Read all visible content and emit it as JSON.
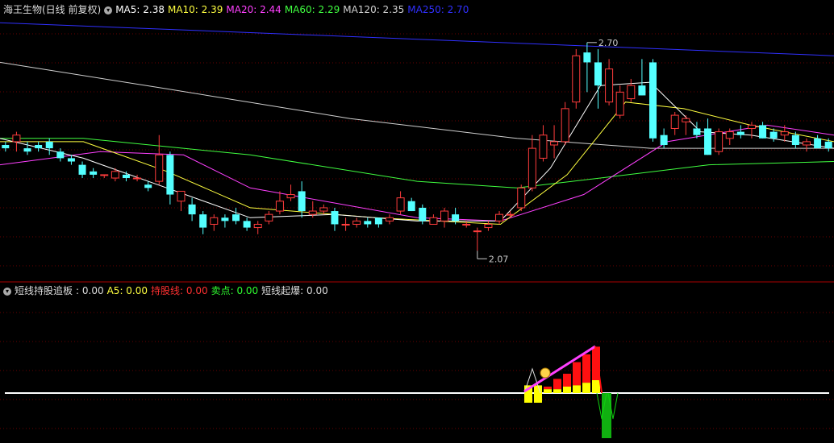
{
  "main_panel": {
    "title": "海王生物(日线 前复权)",
    "indicators": [
      {
        "label": "MA5:",
        "value": "2.38",
        "color": "#ffffff"
      },
      {
        "label": "MA10:",
        "value": "2.39",
        "color": "#ffff40"
      },
      {
        "label": "MA20:",
        "value": "2.44",
        "color": "#ff40ff"
      },
      {
        "label": "MA60:",
        "value": "2.29",
        "color": "#40ff40"
      },
      {
        "label": "MA120:",
        "value": "2.35",
        "color": "#d0d0d0"
      },
      {
        "label": "MA250:",
        "value": "2.70",
        "color": "#3030ff"
      }
    ],
    "high_label": "2.70",
    "low_label": "2.07"
  },
  "sub_panel": {
    "title": "短线持股追板",
    "indicators": [
      {
        "label": ": ",
        "value": "0.00",
        "color": "#dddddd"
      },
      {
        "label": "A5:",
        "value": "0.00",
        "color": "#ffff40"
      },
      {
        "label": "持股线:",
        "value": "0.00",
        "color": "#ff3030"
      },
      {
        "label": "卖点:",
        "value": "0.00",
        "color": "#30ff30"
      },
      {
        "label": "短线起爆:",
        "value": "0.00",
        "color": "#dddddd"
      }
    ]
  },
  "chart_data": {
    "type": "candlestick",
    "price_range": [
      2.0,
      2.78
    ],
    "candles": [
      [
        2.39,
        2.4,
        2.37,
        2.38
      ],
      [
        2.4,
        2.43,
        2.37,
        2.42
      ],
      [
        2.38,
        2.4,
        2.36,
        2.37
      ],
      [
        2.39,
        2.4,
        2.37,
        2.38
      ],
      [
        2.4,
        2.41,
        2.36,
        2.38
      ],
      [
        2.37,
        2.38,
        2.34,
        2.35
      ],
      [
        2.35,
        2.36,
        2.33,
        2.34
      ],
      [
        2.33,
        2.34,
        2.29,
        2.3
      ],
      [
        2.31,
        2.32,
        2.29,
        2.3
      ],
      [
        2.3,
        2.3,
        2.29,
        2.3
      ],
      [
        2.29,
        2.32,
        2.28,
        2.31
      ],
      [
        2.3,
        2.31,
        2.28,
        2.29
      ],
      [
        2.29,
        2.3,
        2.28,
        2.29
      ],
      [
        2.27,
        2.28,
        2.25,
        2.26
      ],
      [
        2.28,
        2.42,
        2.27,
        2.36
      ],
      [
        2.36,
        2.37,
        2.21,
        2.24
      ],
      [
        2.22,
        2.25,
        2.19,
        2.25
      ],
      [
        2.21,
        2.23,
        2.16,
        2.18
      ],
      [
        2.18,
        2.19,
        2.12,
        2.14
      ],
      [
        2.15,
        2.18,
        2.13,
        2.17
      ],
      [
        2.17,
        2.18,
        2.14,
        2.16
      ],
      [
        2.18,
        2.2,
        2.15,
        2.16
      ],
      [
        2.16,
        2.17,
        2.13,
        2.14
      ],
      [
        2.14,
        2.16,
        2.12,
        2.15
      ],
      [
        2.16,
        2.19,
        2.15,
        2.18
      ],
      [
        2.19,
        2.25,
        2.18,
        2.22
      ],
      [
        2.23,
        2.27,
        2.22,
        2.24
      ],
      [
        2.25,
        2.28,
        2.17,
        2.19
      ],
      [
        2.18,
        2.22,
        2.17,
        2.19
      ],
      [
        2.19,
        2.21,
        2.18,
        2.2
      ],
      [
        2.19,
        2.2,
        2.13,
        2.15
      ],
      [
        2.15,
        2.17,
        2.13,
        2.15
      ],
      [
        2.15,
        2.17,
        2.14,
        2.16
      ],
      [
        2.16,
        2.17,
        2.14,
        2.15
      ],
      [
        2.17,
        2.17,
        2.14,
        2.15
      ],
      [
        2.16,
        2.18,
        2.15,
        2.17
      ],
      [
        2.19,
        2.25,
        2.18,
        2.23
      ],
      [
        2.22,
        2.23,
        2.19,
        2.19
      ],
      [
        2.2,
        2.21,
        2.15,
        2.16
      ],
      [
        2.15,
        2.18,
        2.15,
        2.17
      ],
      [
        2.16,
        2.2,
        2.14,
        2.19
      ],
      [
        2.18,
        2.2,
        2.15,
        2.16
      ],
      [
        2.15,
        2.16,
        2.14,
        2.15
      ],
      [
        2.13,
        2.14,
        2.07,
        2.13
      ],
      [
        2.14,
        2.16,
        2.13,
        2.15
      ],
      [
        2.16,
        2.19,
        2.15,
        2.18
      ],
      [
        2.18,
        2.19,
        2.17,
        2.18
      ],
      [
        2.2,
        2.27,
        2.19,
        2.26
      ],
      [
        2.26,
        2.42,
        2.25,
        2.38
      ],
      [
        2.35,
        2.45,
        2.34,
        2.42
      ],
      [
        2.39,
        2.45,
        2.35,
        2.4
      ],
      [
        2.4,
        2.52,
        2.39,
        2.5
      ],
      [
        2.52,
        2.68,
        2.5,
        2.66
      ],
      [
        2.67,
        2.7,
        2.55,
        2.64
      ],
      [
        2.64,
        2.68,
        2.5,
        2.57
      ],
      [
        2.52,
        2.65,
        2.51,
        2.62
      ],
      [
        2.48,
        2.57,
        2.47,
        2.55
      ],
      [
        2.53,
        2.59,
        2.52,
        2.57
      ],
      [
        2.57,
        2.65,
        2.54,
        2.54
      ],
      [
        2.64,
        2.65,
        2.4,
        2.41
      ],
      [
        2.42,
        2.44,
        2.38,
        2.39
      ],
      [
        2.44,
        2.49,
        2.42,
        2.48
      ],
      [
        2.46,
        2.48,
        2.42,
        2.47
      ],
      [
        2.44,
        2.46,
        2.41,
        2.42
      ],
      [
        2.44,
        2.47,
        2.36,
        2.36
      ],
      [
        2.37,
        2.44,
        2.36,
        2.43
      ],
      [
        2.41,
        2.44,
        2.39,
        2.43
      ],
      [
        2.43,
        2.45,
        2.41,
        2.42
      ],
      [
        2.44,
        2.46,
        2.41,
        2.45
      ],
      [
        2.45,
        2.46,
        2.41,
        2.41
      ],
      [
        2.43,
        2.44,
        2.4,
        2.41
      ],
      [
        2.42,
        2.45,
        2.4,
        2.43
      ],
      [
        2.42,
        2.43,
        2.38,
        2.39
      ],
      [
        2.39,
        2.41,
        2.37,
        2.4
      ],
      [
        2.41,
        2.42,
        2.39,
        2.38
      ],
      [
        2.4,
        2.41,
        2.37,
        2.38
      ]
    ],
    "ma_lines": [
      {
        "name": "MA250",
        "color": "#3030ff",
        "points": [
          [
            0,
            2.76
          ],
          [
            1,
            2.66
          ]
        ]
      },
      {
        "name": "MA120",
        "color": "#d0d0d0",
        "points": [
          [
            0,
            2.64
          ],
          [
            0.2,
            2.56
          ],
          [
            0.42,
            2.47
          ],
          [
            0.62,
            2.41
          ],
          [
            0.78,
            2.38
          ],
          [
            1,
            2.38
          ]
        ]
      },
      {
        "name": "MA60",
        "color": "#40ff40",
        "points": [
          [
            0,
            2.41
          ],
          [
            0.1,
            2.41
          ],
          [
            0.3,
            2.36
          ],
          [
            0.5,
            2.28
          ],
          [
            0.62,
            2.26
          ],
          [
            0.72,
            2.29
          ],
          [
            0.85,
            2.33
          ],
          [
            1,
            2.34
          ]
        ]
      },
      {
        "name": "MA20",
        "color": "#ff40ff",
        "points": [
          [
            0,
            2.33
          ],
          [
            0.12,
            2.37
          ],
          [
            0.22,
            2.36
          ],
          [
            0.3,
            2.26
          ],
          [
            0.5,
            2.17
          ],
          [
            0.6,
            2.16
          ],
          [
            0.7,
            2.24
          ],
          [
            0.8,
            2.4
          ],
          [
            0.92,
            2.45
          ],
          [
            1,
            2.42
          ]
        ]
      },
      {
        "name": "MA10",
        "color": "#ffff40",
        "points": [
          [
            0,
            2.4
          ],
          [
            0.1,
            2.4
          ],
          [
            0.2,
            2.31
          ],
          [
            0.3,
            2.2
          ],
          [
            0.45,
            2.17
          ],
          [
            0.6,
            2.15
          ],
          [
            0.68,
            2.3
          ],
          [
            0.75,
            2.52
          ],
          [
            0.82,
            2.5
          ],
          [
            0.9,
            2.45
          ],
          [
            1,
            2.4
          ]
        ]
      },
      {
        "name": "MA5",
        "color": "#ffffff",
        "points": [
          [
            0,
            2.41
          ],
          [
            0.05,
            2.38
          ],
          [
            0.1,
            2.35
          ],
          [
            0.2,
            2.26
          ],
          [
            0.3,
            2.17
          ],
          [
            0.4,
            2.18
          ],
          [
            0.5,
            2.16
          ],
          [
            0.6,
            2.16
          ],
          [
            0.66,
            2.32
          ],
          [
            0.72,
            2.57
          ],
          [
            0.78,
            2.58
          ],
          [
            0.84,
            2.43
          ],
          [
            0.9,
            2.42
          ],
          [
            1,
            2.38
          ]
        ]
      }
    ],
    "sub_bars": {
      "yellow": [
        0.6,
        0.6,
        0.3,
        0.3,
        0.5,
        0.6,
        0.8,
        1.0
      ],
      "red": [
        0,
        0,
        0.2,
        0.8,
        1.0,
        1.8,
        2.2,
        2.6
      ],
      "green": [
        3.5
      ]
    }
  }
}
